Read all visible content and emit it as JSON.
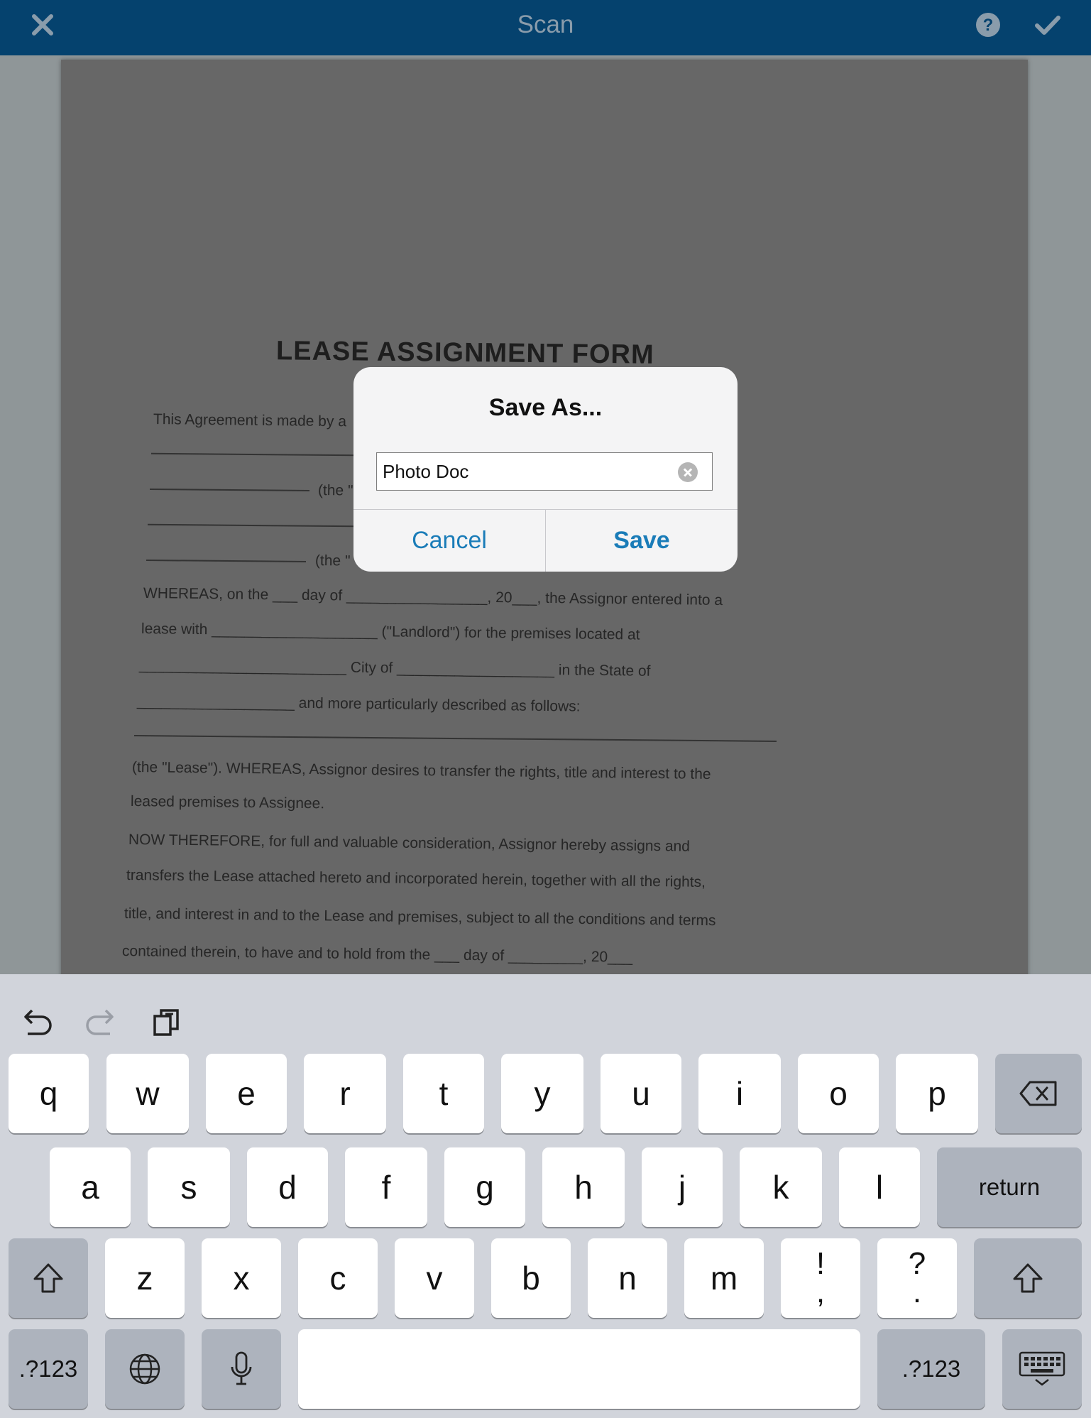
{
  "nav": {
    "title": "Scan",
    "close_icon": "close-x-icon",
    "help_icon": "help-circle-icon",
    "done_icon": "checkmark-icon"
  },
  "document": {
    "title": "LEASE ASSIGNMENT FORM",
    "lines": [
      "This Agreement is made by a",
      "(the \"",
      "(the \"",
      "WHEREAS, on the ___ day of _________________, 20___, the Assignor entered into a",
      "lease with ____________________ (\"Landlord\") for the premises located at",
      "_________________________ City of ___________________ in the State of",
      "___________________ and more particularly described as follows:",
      "(the \"Lease\"). WHEREAS, Assignor desires to transfer the rights, title and interest to the",
      "leased premises to Assignee.",
      "NOW THEREFORE, for full and valuable consideration, Assignor hereby assigns and",
      "transfers the Lease attached hereto and incorporated herein, together with all the rights,",
      "title, and interest in and to the Lease and premises, subject to all the conditions and terms",
      "contained therein, to have and to hold from the ___ day of _________, 20___"
    ]
  },
  "dialog": {
    "title": "Save As...",
    "filename_value": "Photo Doc",
    "clear_icon": "clear-circle-icon",
    "cancel_label": "Cancel",
    "save_label": "Save"
  },
  "keyboard": {
    "toolbar": [
      "undo-icon",
      "redo-icon",
      "paste-icon"
    ],
    "row1": [
      "q",
      "w",
      "e",
      "r",
      "t",
      "y",
      "u",
      "i",
      "o",
      "p"
    ],
    "row2": [
      "a",
      "s",
      "d",
      "f",
      "g",
      "h",
      "j",
      "k",
      "l"
    ],
    "row3": [
      "z",
      "x",
      "c",
      "v",
      "b",
      "n",
      "m"
    ],
    "punct1_top": "!",
    "punct1_bottom": ",",
    "punct2_top": "?",
    "punct2_bottom": ".",
    "return_label": "return",
    "numbers_label": ".?123",
    "numbers_label_right": ".?123",
    "space_label": ""
  },
  "colors": {
    "nav_bar": "#05426e",
    "accent": "#1a7cb8",
    "keyboard_bg": "#d1d4db"
  }
}
